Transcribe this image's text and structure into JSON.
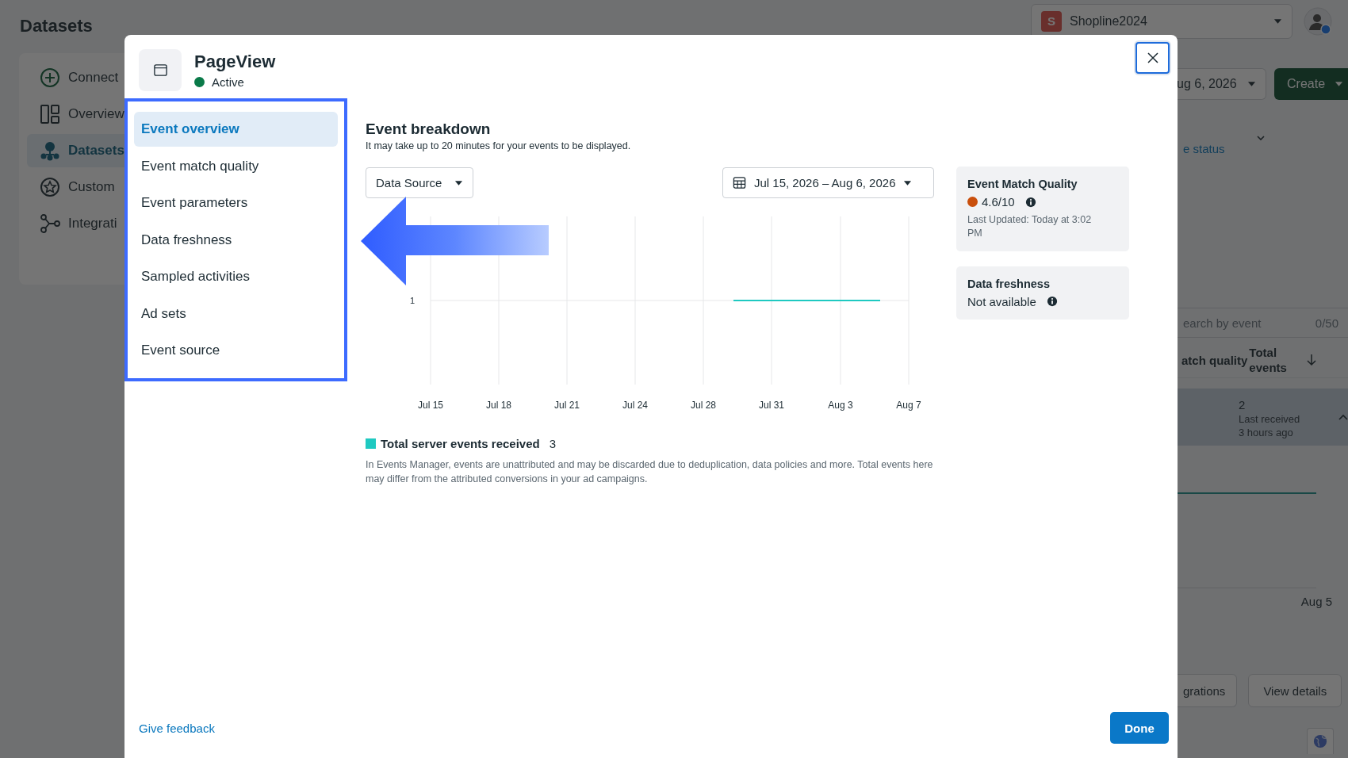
{
  "background": {
    "title": "Datasets",
    "nav": [
      {
        "label": "Connect",
        "selected": false
      },
      {
        "label": "Overview",
        "selected": false
      },
      {
        "label": "Datasets",
        "selected": true
      },
      {
        "label": "Custom",
        "selected": false
      },
      {
        "label": "Integrati",
        "selected": false
      }
    ],
    "account": {
      "initial": "S",
      "name": "Shopline2024"
    },
    "date_select": "ug 6, 2026",
    "create_button": "Create",
    "status_link": "e status",
    "search": {
      "placeholder": "earch by event",
      "count": "0/50"
    },
    "columns": [
      "atch quality",
      "Total events"
    ],
    "row": {
      "value": "2",
      "note": "Last received 3 hours ago",
      "selected": true
    },
    "date_label": "Aug 5",
    "buttons": [
      "grations",
      "View details"
    ]
  },
  "modal": {
    "title": "PageView",
    "status": {
      "label": "Active",
      "active": true
    },
    "menu": [
      {
        "label": "Event overview",
        "selected": true
      },
      {
        "label": "Event match quality",
        "selected": false
      },
      {
        "label": "Event parameters",
        "selected": false
      },
      {
        "label": "Data freshness",
        "selected": false
      },
      {
        "label": "Sampled activities",
        "selected": false
      },
      {
        "label": "Ad sets",
        "selected": false
      },
      {
        "label": "Event source",
        "selected": false
      }
    ],
    "breakdown": {
      "title": "Event breakdown",
      "subtitle": "It may take up to 20 minutes for your events to be displayed.",
      "source_dropdown": "Data Source",
      "date_range": "Jul 15, 2026 – Aug 6, 2026",
      "chart": {
        "y_labels": [
          "1"
        ],
        "x_labels": [
          "Jul 15",
          "Jul 18",
          "Jul 21",
          "Jul 24",
          "Jul 28",
          "Jul 31",
          "Aug 3",
          "Aug 7"
        ]
      },
      "legend": {
        "label": "Total server events received",
        "value": "3"
      },
      "note": "In Events Manager, events are unattributed and may be discarded due to deduplication, data policies and more. Total events here may differ from the attributed conversions in your ad campaigns."
    },
    "cards": [
      {
        "title": "Event Match Quality",
        "value": "4.6/10",
        "color": "#c94f0c",
        "detail": "Last Updated: Today at 3:02 PM"
      },
      {
        "title": "Data freshness",
        "value": "Not available"
      }
    ],
    "feedback_link": "Give feedback",
    "done_button": "Done"
  }
}
